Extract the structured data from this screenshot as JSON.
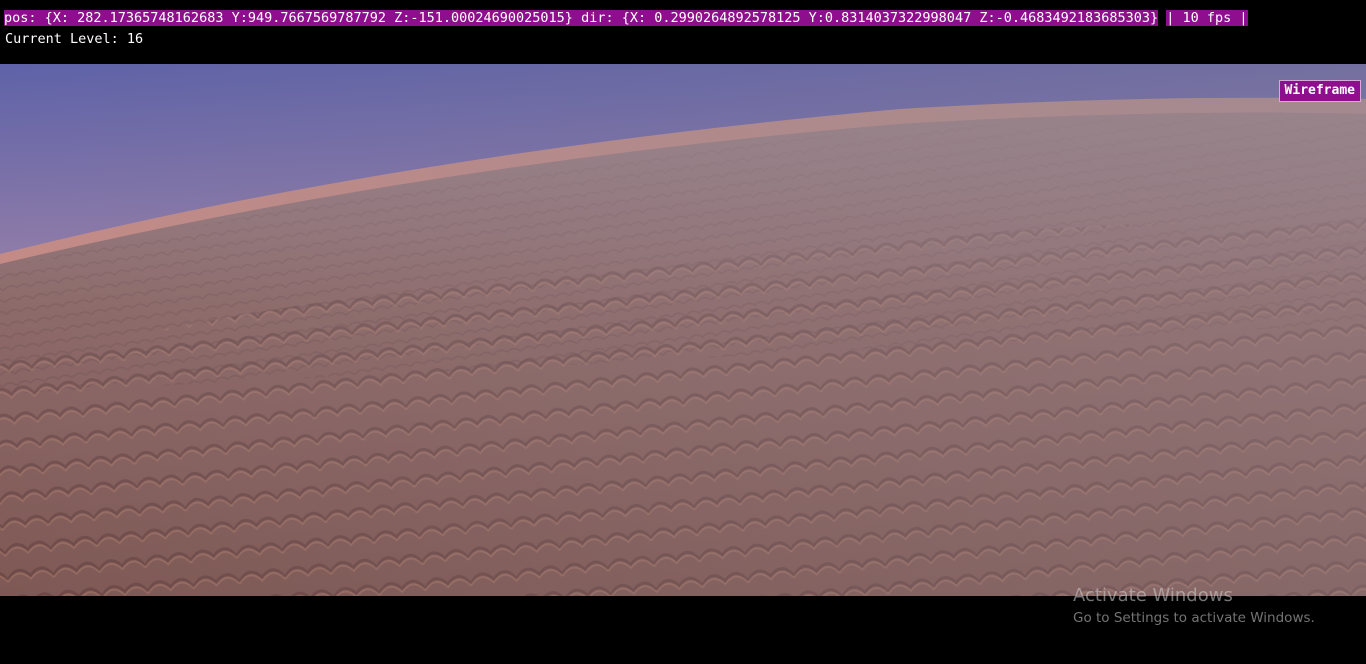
{
  "hud": {
    "debug_line": "pos: {X: 282.17365748162683 Y:949.7667569787792 Z:-151.00024690025015} dir: {X: 0.2990264892578125 Y:0.8314037322998047 Z:-0.4683492183685303}",
    "fps_label": "| 10 fps |",
    "level_label": "Current Level: 16",
    "accent_color": "#8e0f8e"
  },
  "controls": {
    "wireframe_label": "Wireframe"
  },
  "scene": {
    "icon": "terrain-render-viewport",
    "sky_color": "#6b6aa6",
    "horizon_color": "#c98f7c",
    "ground_color": "#8a5d56"
  },
  "watermark": {
    "title": "Activate Windows",
    "subtitle": "Go to Settings to activate Windows."
  }
}
